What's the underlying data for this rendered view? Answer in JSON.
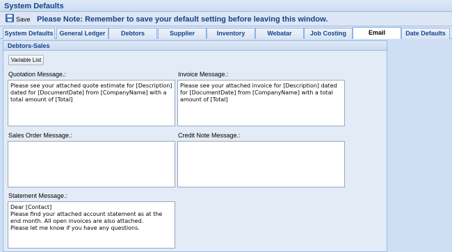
{
  "window": {
    "title": "System Defaults"
  },
  "toolbar": {
    "save_label": "Save",
    "note": "Please Note: Remember to save your default setting before leaving this window."
  },
  "tabs": [
    {
      "label": "System Defaults"
    },
    {
      "label": "General Ledger"
    },
    {
      "label": "Debtors"
    },
    {
      "label": "Supplier"
    },
    {
      "label": "Inventory"
    },
    {
      "label": "Webatar"
    },
    {
      "label": "Job Costing"
    },
    {
      "label": "Email",
      "active": true
    },
    {
      "label": "Date Defaults"
    }
  ],
  "panel": {
    "title": "Debtors-Sales",
    "variable_list_label": "Variable List",
    "fields": {
      "quotation": {
        "label": "Quotation Message.:",
        "value": "Please see your attached quote estimate for [Description] dated for [DocumentDate] from [CompanyName] with a total amount of [Total]"
      },
      "invoice": {
        "label": "Invoice Message.:",
        "value": "Please see your attached invoice for [Description] dated for [DocumentDate] from [CompanyName] with a total amount of [Total]"
      },
      "sales_order": {
        "label": "Sales Order Message.:",
        "value": ""
      },
      "credit_note": {
        "label": "Credit Note Message.:",
        "value": ""
      },
      "statement": {
        "label": "Statement Message.:",
        "value": "Dear [Contact]\nPlease find your attached account statement as at the end month. All open invoices are also attached.\nPlease let me know if you have any questions."
      }
    }
  },
  "icons": {
    "save": "floppy-disk-icon"
  },
  "colors": {
    "header_text": "#15428b",
    "border": "#99bbe8",
    "body_bg": "#e3ebf6"
  }
}
